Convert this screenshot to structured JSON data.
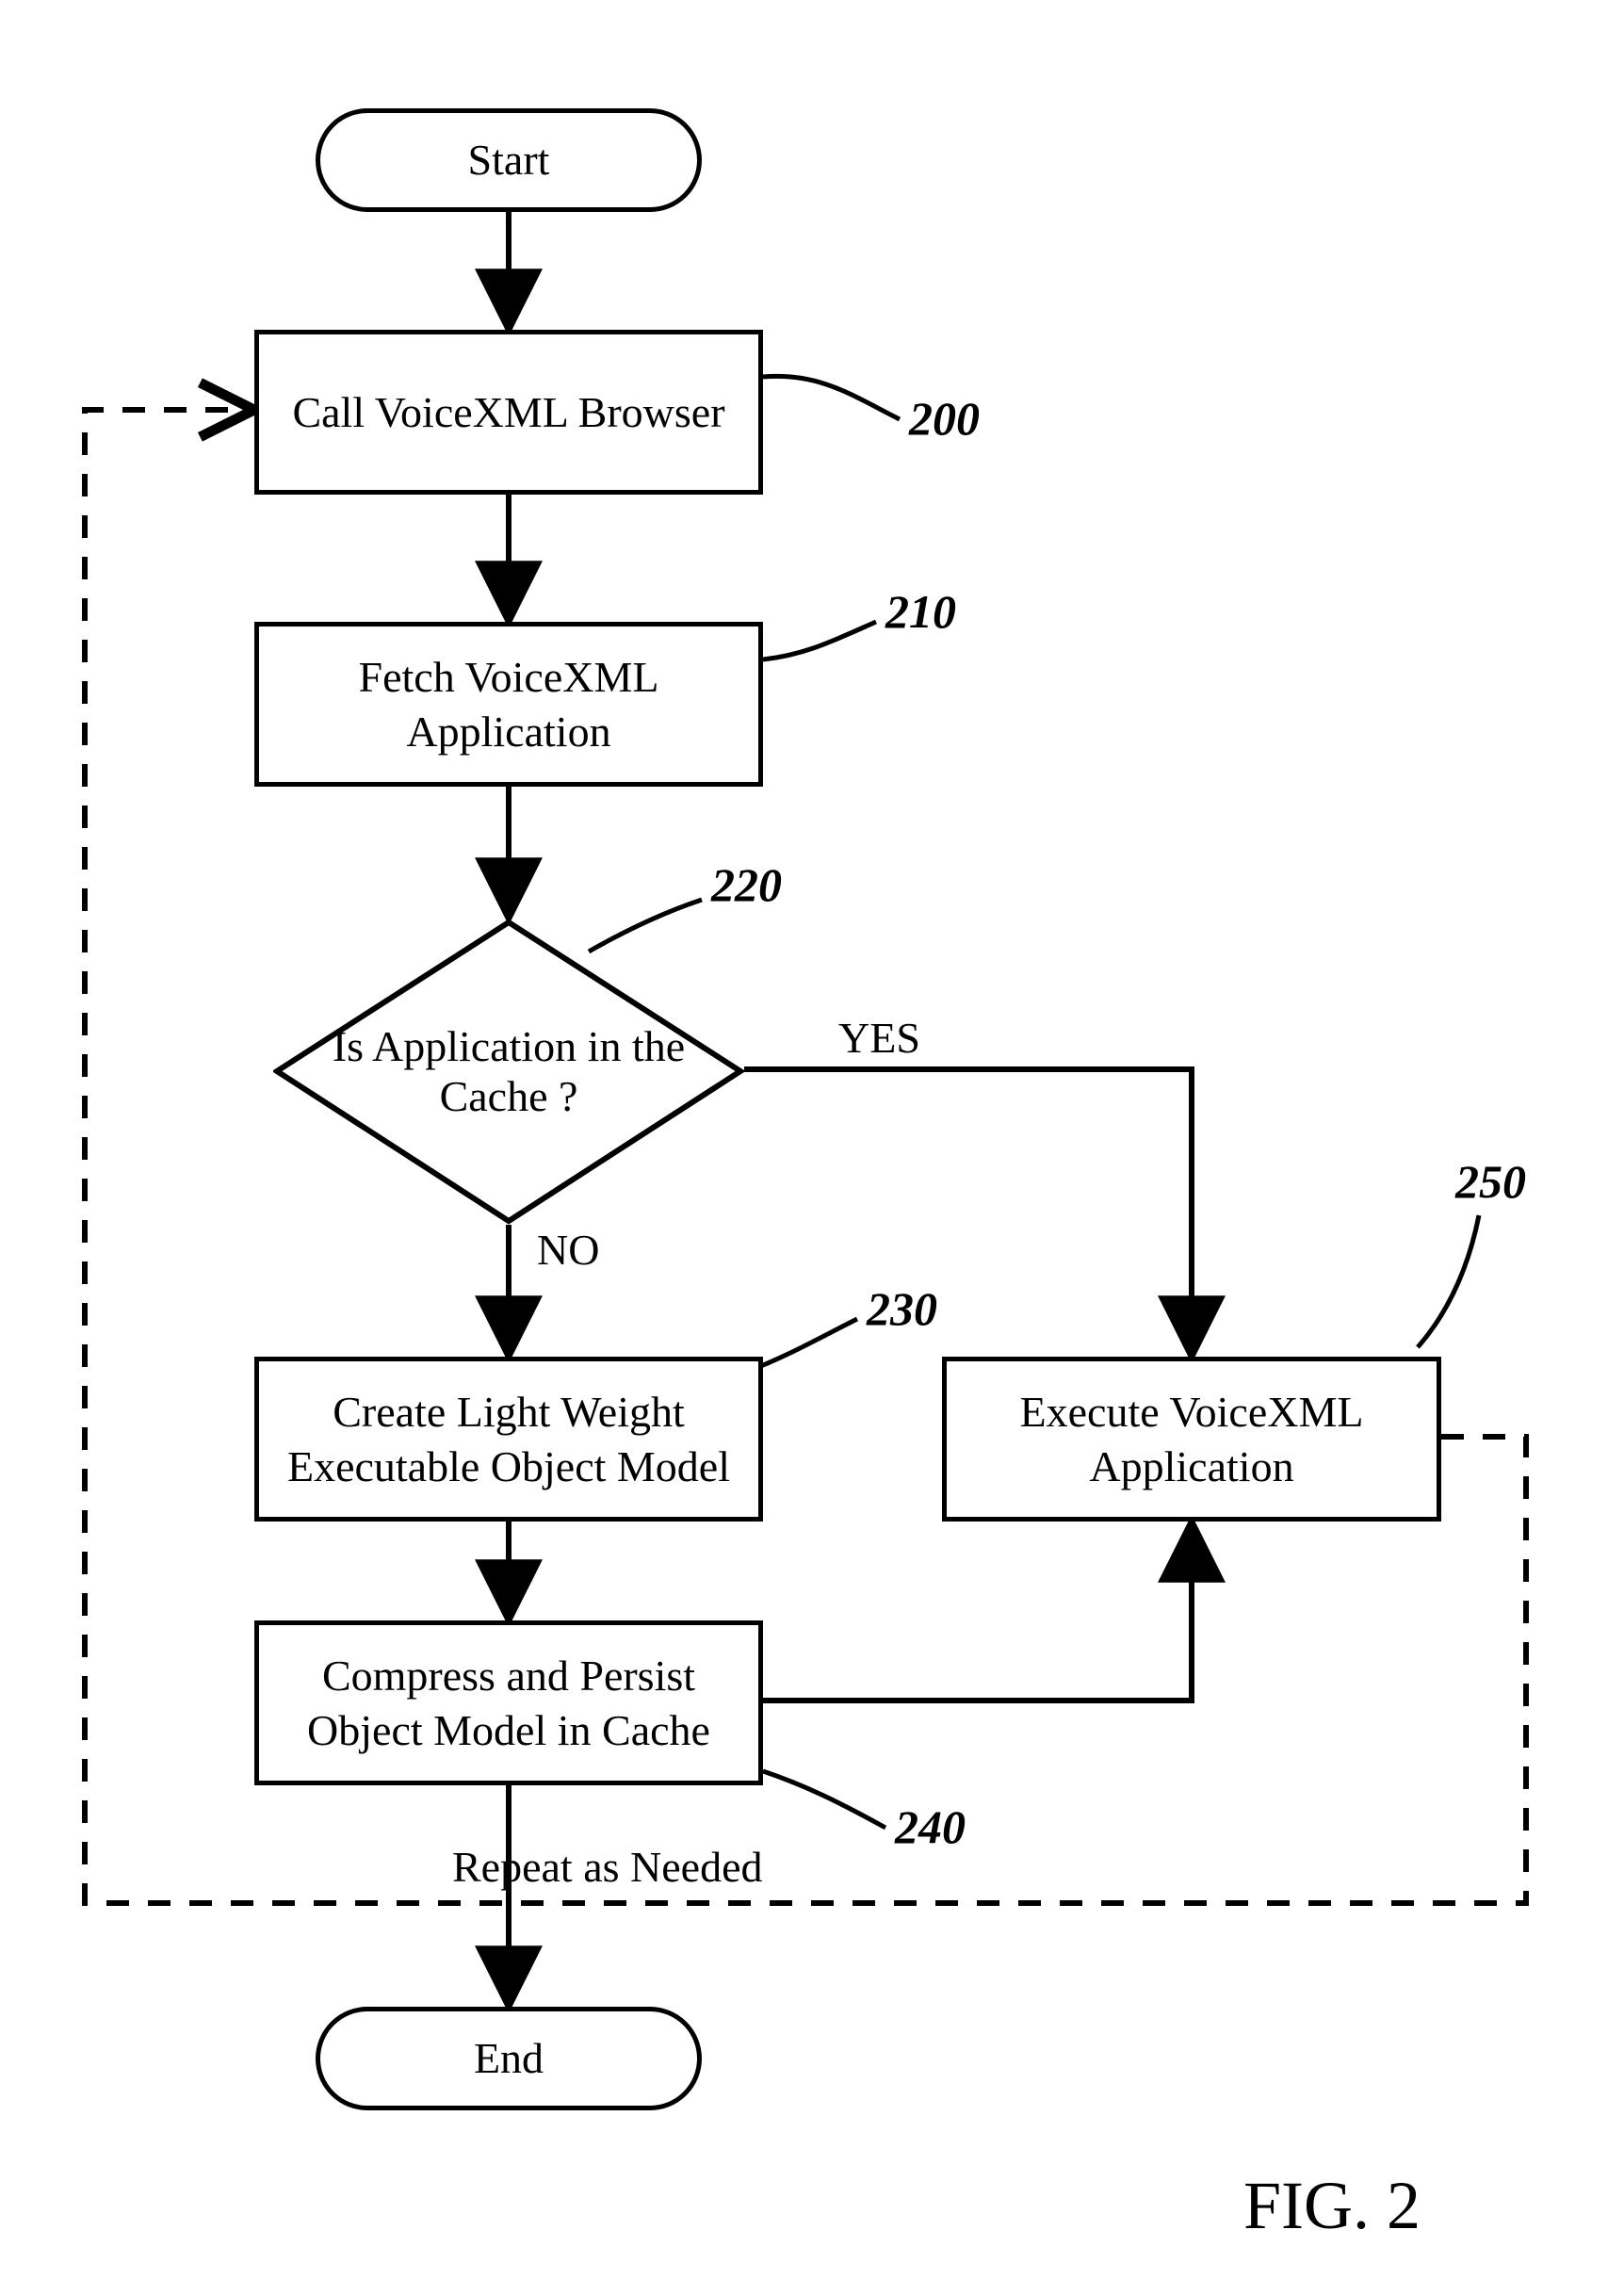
{
  "terminals": {
    "start": "Start",
    "end": "End"
  },
  "processes": {
    "p200": "Call VoiceXML Browser",
    "p210": "Fetch VoiceXML Application",
    "p230": "Create Light Weight Executable Object Model",
    "p240": "Compress and Persist Object Model in Cache",
    "p250": "Execute VoiceXML Application"
  },
  "decisions": {
    "d220": "Is Application in the Cache ?"
  },
  "edge_labels": {
    "yes": "YES",
    "no": "NO",
    "repeat": "Repeat as Needed"
  },
  "refs": {
    "r200": "200",
    "r210": "210",
    "r220": "220",
    "r230": "230",
    "r240": "240",
    "r250": "250"
  },
  "figure": "FIG. 2"
}
